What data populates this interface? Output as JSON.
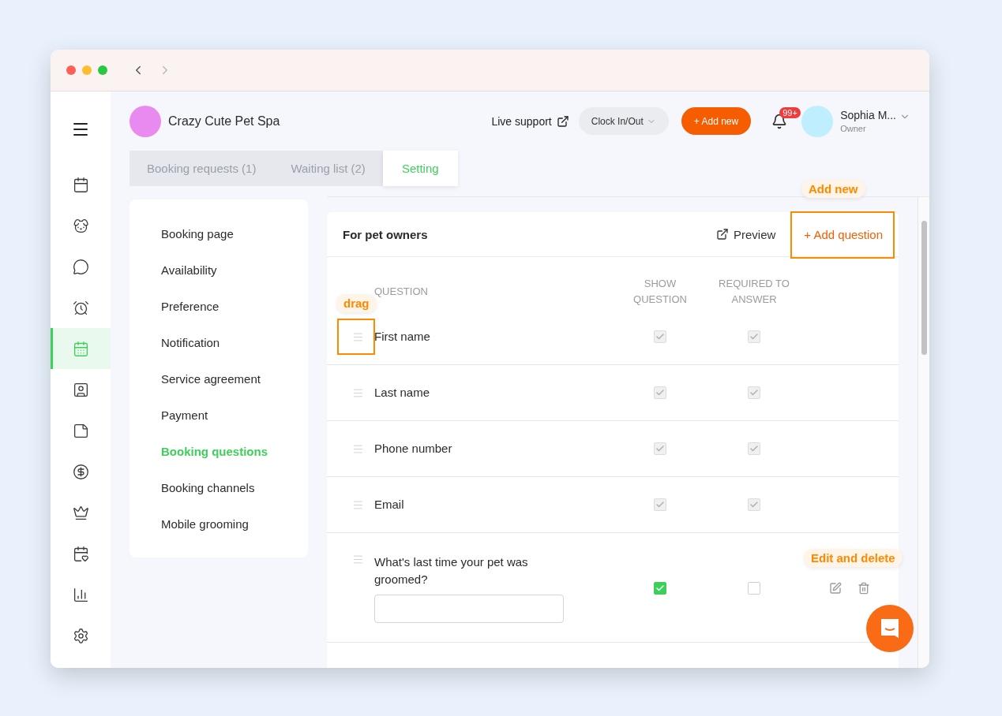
{
  "window": {
    "nav": [
      {
        "kind": "back",
        "disabled": false
      },
      {
        "kind": "forward",
        "disabled": true
      }
    ]
  },
  "sidebar": {
    "items": [
      {
        "selected": false
      },
      {
        "selected": false
      },
      {
        "selected": false
      },
      {
        "selected": false
      },
      {
        "selected": true
      },
      {
        "selected": false
      },
      {
        "selected": false
      },
      {
        "selected": false
      },
      {
        "selected": false
      },
      {
        "selected": false
      },
      {
        "selected": false
      },
      {
        "selected": false
      }
    ]
  },
  "header": {
    "business": "Crazy Cute Pet Spa",
    "live_support": "Live support",
    "clock": "Clock In/Out",
    "add_new": "+ Add new",
    "notifications": "99+",
    "user": {
      "name": "Sophia M...",
      "role": "Owner"
    }
  },
  "tabs": [
    {
      "label": "Booking requests (1)",
      "selected": false
    },
    {
      "label": "Waiting list (2)",
      "selected": false
    },
    {
      "label": "Setting",
      "selected": true
    }
  ],
  "settings_menu": [
    {
      "label": "Booking page",
      "selected": false
    },
    {
      "label": "Availability",
      "selected": false
    },
    {
      "label": "Preference",
      "selected": false
    },
    {
      "label": "Notification",
      "selected": false
    },
    {
      "label": "Service agreement",
      "selected": false
    },
    {
      "label": "Payment",
      "selected": false
    },
    {
      "label": "Booking questions",
      "selected": true
    },
    {
      "label": "Booking channels",
      "selected": false
    },
    {
      "label": "Mobile grooming",
      "selected": false
    }
  ],
  "questions": {
    "title": "For pet owners",
    "preview": "Preview",
    "add": "+ Add question",
    "columns": [
      "QUESTION",
      "SHOW QUESTION",
      "REQUIRED TO ANSWER"
    ],
    "rows": [
      {
        "label": "First name",
        "show": true,
        "required": true,
        "locked": true,
        "has_input": false
      },
      {
        "label": "Last name",
        "show": true,
        "required": true,
        "locked": true,
        "has_input": false
      },
      {
        "label": "Phone number",
        "show": true,
        "required": true,
        "locked": true,
        "has_input": false
      },
      {
        "label": "Email",
        "show": true,
        "required": true,
        "locked": true,
        "has_input": false
      },
      {
        "label": "What's last time your pet was groomed?",
        "show": true,
        "required": false,
        "locked": false,
        "has_input": true
      }
    ]
  },
  "annotations": [
    "Add new",
    "drag",
    "Edit and delete"
  ]
}
